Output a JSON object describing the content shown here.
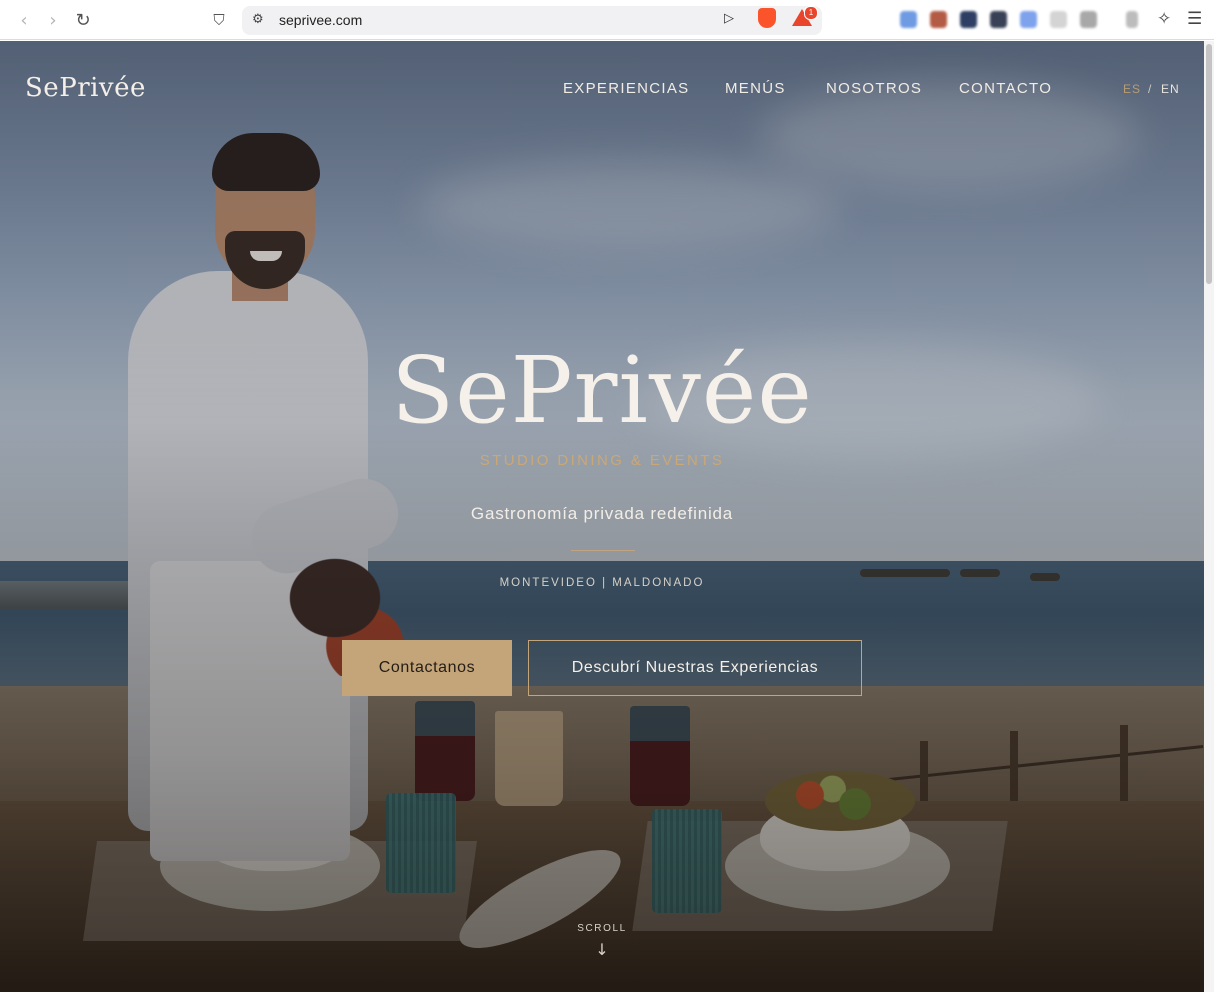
{
  "browser": {
    "url": "seprivee.com",
    "rewards_badge": "1",
    "icons": {
      "back": "chevron-left-icon",
      "forward": "chevron-right-icon",
      "reload": "reload-icon",
      "bookmark": "bookmark-icon",
      "site_info": "site-settings-icon",
      "share": "send-icon",
      "brave_shields": "brave-shield-icon",
      "rewards": "rewards-triangle-icon",
      "leo": "sparkle-icon",
      "menu": "hamburger-menu-icon"
    }
  },
  "site": {
    "brand": "SePrivée",
    "nav": [
      "EXPERIENCIAS",
      "MENÚS",
      "NOSOTROS",
      "CONTACTO"
    ],
    "lang": {
      "es": "ES",
      "separator": "/",
      "en": "EN"
    },
    "hero": {
      "title": "SePrivée",
      "subtitle": "STUDIO DINING & EVENTS",
      "tagline": "Gastronomía privada redefinida",
      "location": "MONTEVIDEO | MALDONADO",
      "primary_cta": "Contactanos",
      "secondary_cta": "Descubrí Nuestras Experiencias",
      "scroll_label": "SCROLL",
      "scroll_icon": "arrow-down-icon"
    }
  },
  "colors": {
    "accent_gold": "#c4a57a",
    "text_light": "#f5f1ea",
    "brave_orange": "#fb542b"
  }
}
